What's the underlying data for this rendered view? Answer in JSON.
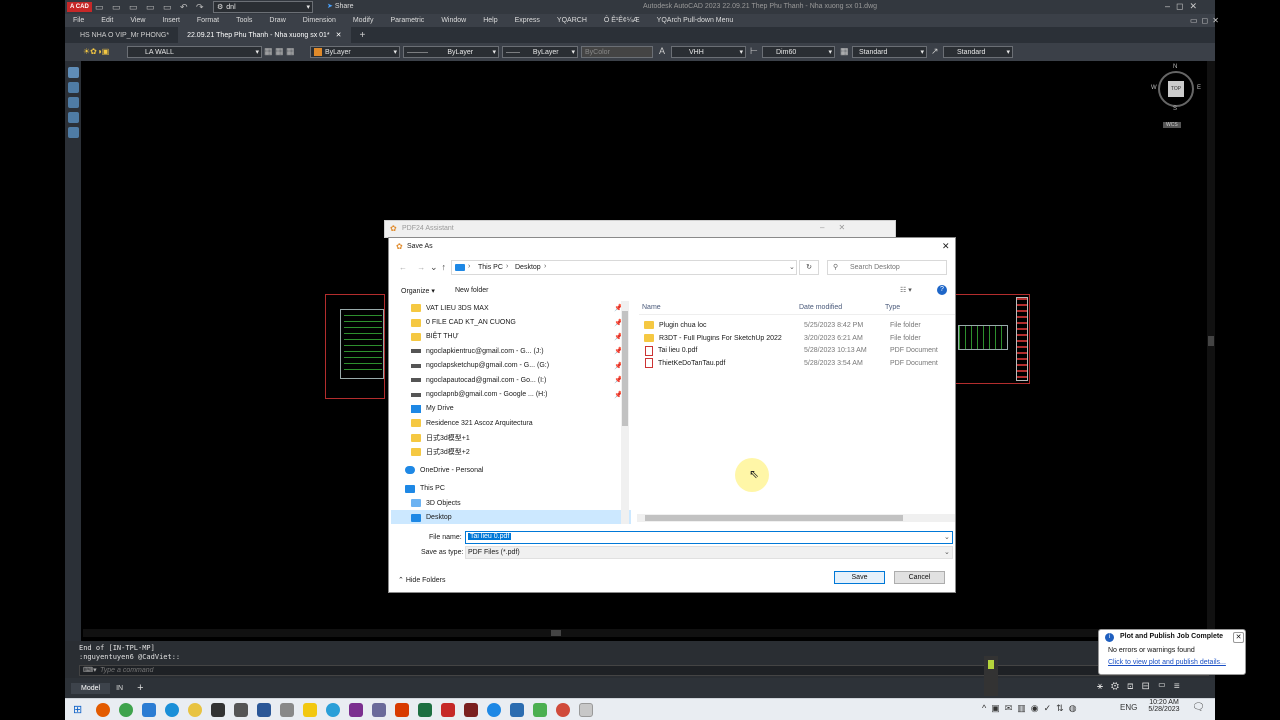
{
  "titlebar": {
    "app_badge": "A CAD",
    "workspace": "dnl",
    "share": "Share",
    "title": "Autodesk AutoCAD 2023    22.09.21 Thep Phu Thanh - Nha xuong sx 01.dwg"
  },
  "menu": [
    "File",
    "Edit",
    "View",
    "Insert",
    "Format",
    "Tools",
    "Draw",
    "Dimension",
    "Modify",
    "Parametric",
    "Window",
    "Help",
    "Express",
    "YQARCH",
    "Ô Ê¹Ê¢¼Æ",
    "YQArch Pull-down Menu"
  ],
  "doc_tabs": [
    "HS NHA O VIP_Mr PHONG*",
    "22.09.21 Thep Phu Thanh - Nha xuong sx 01*"
  ],
  "properties": {
    "layer": "LA WALL",
    "color": "ByLayer",
    "linetype": "ByLayer",
    "lineweight": "ByLayer",
    "plotstyle": "ByColor",
    "textstyle": "VHH",
    "dimstyle": "Dim60",
    "tablestyle": "Standard",
    "mleaderstyle": "Standard"
  },
  "viewcube": {
    "n": "N",
    "s": "S",
    "e": "E",
    "w": "W",
    "top": "TOP",
    "ucs": "WCS"
  },
  "pdf24": {
    "title": "PDF24 Assistant"
  },
  "save_dialog": {
    "title": "Save As",
    "breadcrumb": [
      "This PC",
      "Desktop"
    ],
    "search_placeholder": "Search Desktop",
    "organize": "Organize",
    "new_folder": "New folder",
    "nav_items": [
      {
        "label": "VAT LIEU 3DS MAX",
        "type": "folder",
        "pinned": true
      },
      {
        "label": "0 FILE CAD KT_AN CUONG",
        "type": "folder",
        "pinned": true
      },
      {
        "label": "BIỆT THỰ",
        "type": "folder",
        "pinned": true
      },
      {
        "label": "ngoclapkientruc@gmail.com - G... (J:)",
        "type": "drive",
        "pinned": true
      },
      {
        "label": "ngoclapsketchup@gmail.com - G... (G:)",
        "type": "drive",
        "pinned": true
      },
      {
        "label": "ngoclapautocad@gmail.com - Go... (I:)",
        "type": "drive",
        "pinned": true
      },
      {
        "label": "ngoclapnb@gmail.com - Google ... (H:)",
        "type": "drive",
        "pinned": true
      },
      {
        "label": "My Drive",
        "type": "drive",
        "pinned": false
      },
      {
        "label": "Residence 321  Ascoz Arquitectura",
        "type": "folder",
        "pinned": false
      },
      {
        "label": "日式3d模型+1",
        "type": "folder",
        "pinned": false
      },
      {
        "label": "日式3d模型+2",
        "type": "folder",
        "pinned": false
      }
    ],
    "onedrive": "OneDrive - Personal",
    "this_pc": "This PC",
    "objects3d": "3D Objects",
    "desktop": "Desktop",
    "columns": [
      "Name",
      "Date modified",
      "Type"
    ],
    "files": [
      {
        "name": "Plugin chua loc",
        "date": "5/25/2023 8:42 PM",
        "type": "File folder",
        "kind": "folder"
      },
      {
        "name": "R3DT - Full Plugins For SketchUp 2022",
        "date": "3/20/2023 6:21 AM",
        "type": "File folder",
        "kind": "folder"
      },
      {
        "name": "Tai lieu 0.pdf",
        "date": "5/28/2023 10:13 AM",
        "type": "PDF Document",
        "kind": "pdf"
      },
      {
        "name": "ThietKeDoTanTau.pdf",
        "date": "5/28/2023 3:54 AM",
        "type": "PDF Document",
        "kind": "pdf"
      }
    ],
    "file_name_label": "File name:",
    "file_name_value": "Tai lieu 0.pdf",
    "save_type_label": "Save as type:",
    "save_type_value": "PDF Files (*.pdf)",
    "hide_folders": "Hide Folders",
    "save": "Save",
    "cancel": "Cancel"
  },
  "command": {
    "history1": "End of [IN-TPL-MP]",
    "history2": ":nguyentuyen6 @CadViet::",
    "placeholder": "Type a command"
  },
  "status": {
    "model": "Model",
    "layout": "IN",
    "add": "+"
  },
  "notification": {
    "title": "Plot and Publish Job Complete",
    "line1": "No errors or warnings found",
    "link": "Click to view plot and publish details..."
  },
  "tray": {
    "lang": "ENG",
    "time": "10:20 AM",
    "date": "5/28/2023"
  },
  "colors": {
    "accent": "#0078d7",
    "autocad_red": "#c62828",
    "folder": "#f5c842"
  }
}
